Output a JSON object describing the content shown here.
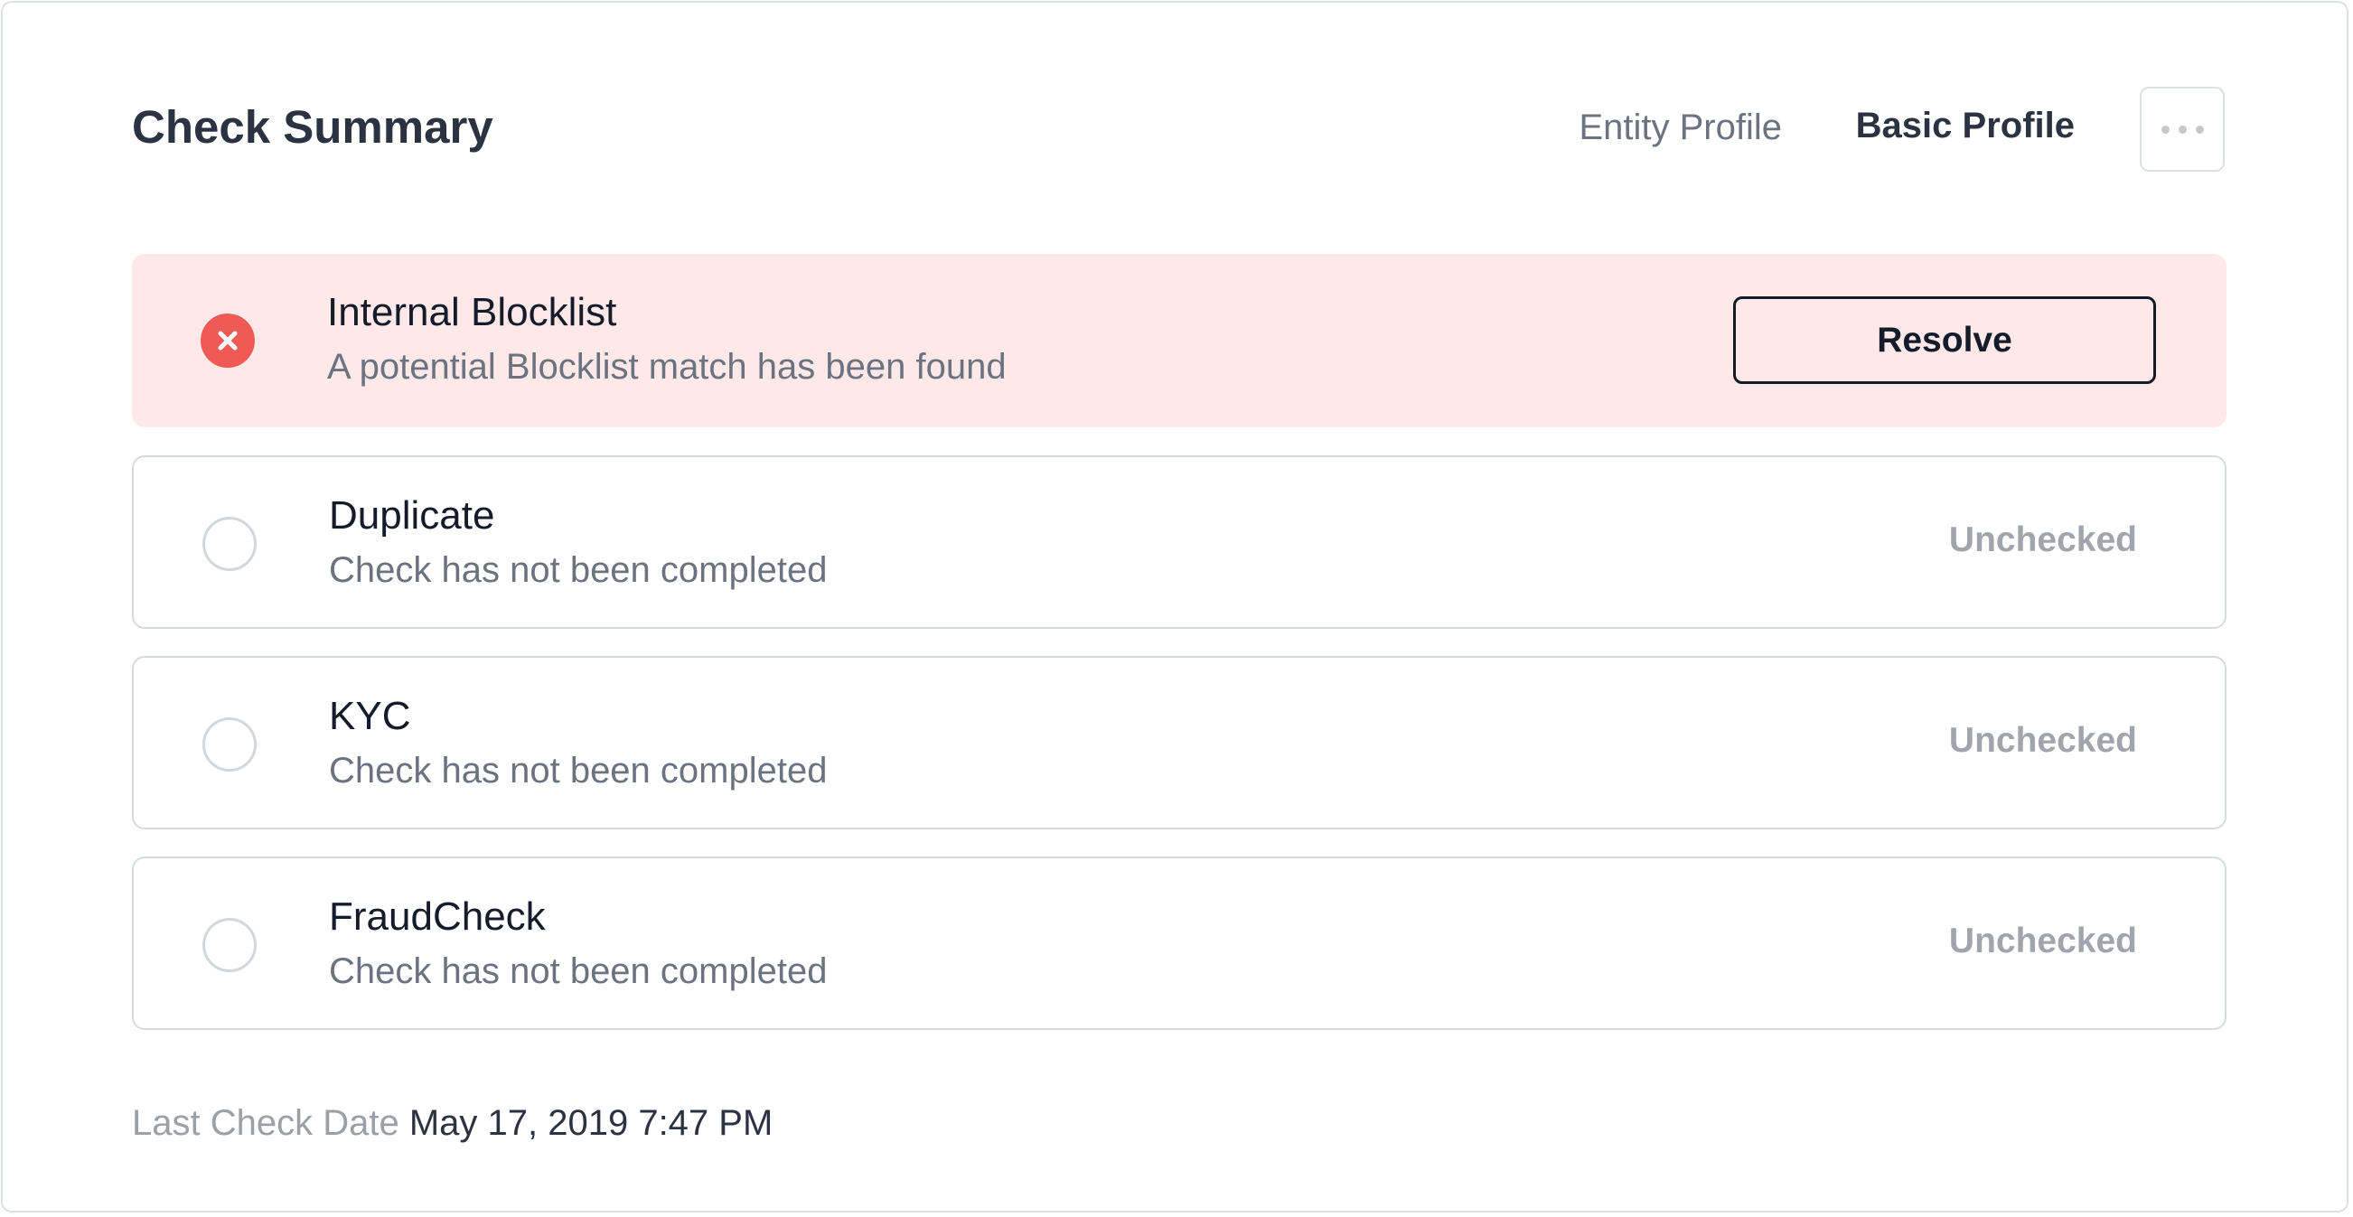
{
  "header": {
    "title": "Check Summary",
    "profile_label": "Entity Profile",
    "profile_value": "Basic Profile",
    "more_icon": "more-horizontal-icon"
  },
  "checks": [
    {
      "name": "Internal Blocklist",
      "description": "A potential Blocklist match has been found",
      "status": "failed",
      "status_icon": "close-circle-icon",
      "action_label": "Resolve"
    },
    {
      "name": "Duplicate",
      "description": "Check has not been completed",
      "status": "unchecked",
      "status_icon": "empty-circle-icon",
      "status_label": "Unchecked"
    },
    {
      "name": "KYC",
      "description": "Check has not been completed",
      "status": "unchecked",
      "status_icon": "empty-circle-icon",
      "status_label": "Unchecked"
    },
    {
      "name": "FraudCheck",
      "description": "Check has not been completed",
      "status": "unchecked",
      "status_icon": "empty-circle-icon",
      "status_label": "Unchecked"
    }
  ],
  "footer": {
    "label": "Last Check Date",
    "value": "May 17, 2019 7:47 PM"
  },
  "colors": {
    "failed_background": "#ffe8e8",
    "failed_icon": "#f05a56",
    "unchecked_text": "#a0a5ad",
    "primary_text": "#2b3241"
  }
}
